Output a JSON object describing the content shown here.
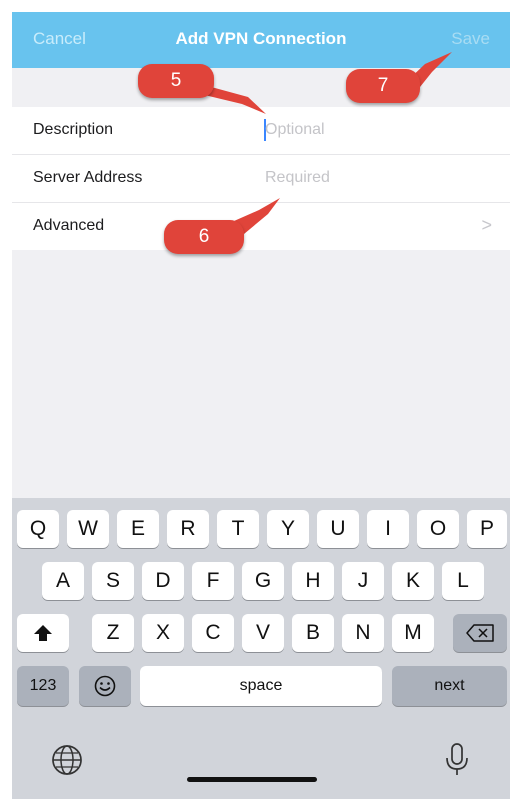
{
  "nav": {
    "cancel_label": "Cancel",
    "title": "Add VPN Connection",
    "save_label": "Save"
  },
  "form": {
    "rows": [
      {
        "label": "Description",
        "placeholder": "Optional"
      },
      {
        "label": "Server Address",
        "placeholder": "Required"
      },
      {
        "label": "Advanced",
        "chevron": ">"
      }
    ]
  },
  "callouts": [
    "5",
    "6",
    "7"
  ],
  "keyboard": {
    "row1": [
      "Q",
      "W",
      "E",
      "R",
      "T",
      "Y",
      "U",
      "I",
      "O",
      "P"
    ],
    "row2": [
      "A",
      "S",
      "D",
      "F",
      "G",
      "H",
      "J",
      "K",
      "L"
    ],
    "row3": [
      "Z",
      "X",
      "C",
      "V",
      "B",
      "N",
      "M"
    ],
    "numbers_label": "123",
    "space_label": "space",
    "next_label": "next",
    "icons": [
      "shift-icon",
      "backspace-icon",
      "emoji-icon",
      "globe-icon",
      "microphone-icon"
    ]
  },
  "colors": {
    "nav_background": "#68c3ee",
    "callout": "#e0443a",
    "keyboard_background": "#d1d4da"
  }
}
